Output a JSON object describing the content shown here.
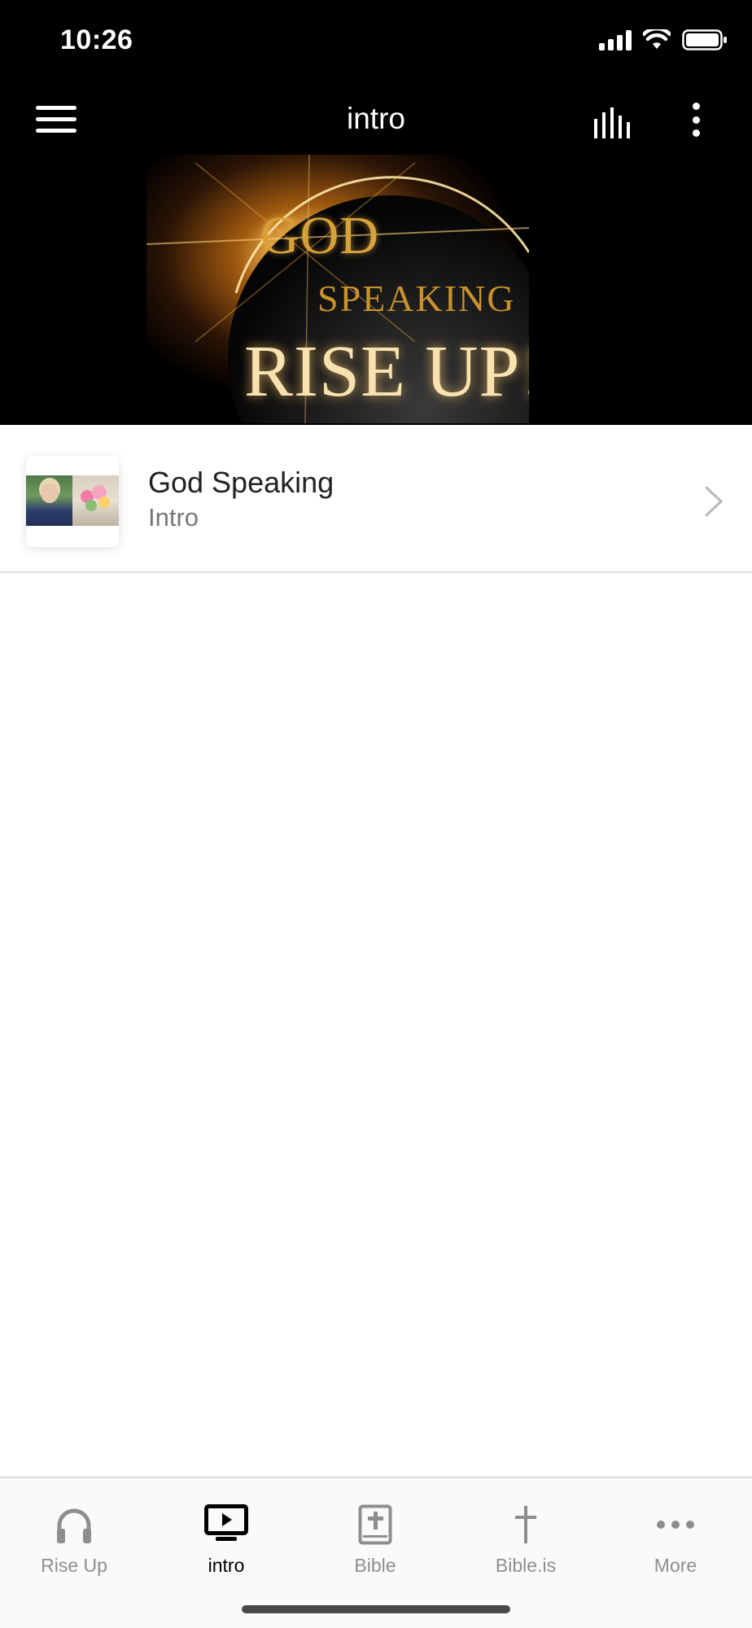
{
  "status_bar": {
    "time": "10:26"
  },
  "header": {
    "title": "intro"
  },
  "banner": {
    "line1": "GOD",
    "line2": "SPEAKING",
    "line3": "RISE UP!"
  },
  "list": [
    {
      "title": "God Speaking",
      "subtitle": "Intro"
    }
  ],
  "tabs": [
    {
      "label": "Rise Up",
      "icon": "headphones-icon",
      "active": false
    },
    {
      "label": "intro",
      "icon": "tv-play-icon",
      "active": true
    },
    {
      "label": "Bible",
      "icon": "bible-book-icon",
      "active": false
    },
    {
      "label": "Bible.is",
      "icon": "cross-icon",
      "active": false
    },
    {
      "label": "More",
      "icon": "more-dots-icon",
      "active": false
    }
  ],
  "colors": {
    "header_bg": "#000000",
    "active_tab": "#000000",
    "inactive_tab": "#8e8e8e",
    "banner_gold": "#d7a23a"
  }
}
